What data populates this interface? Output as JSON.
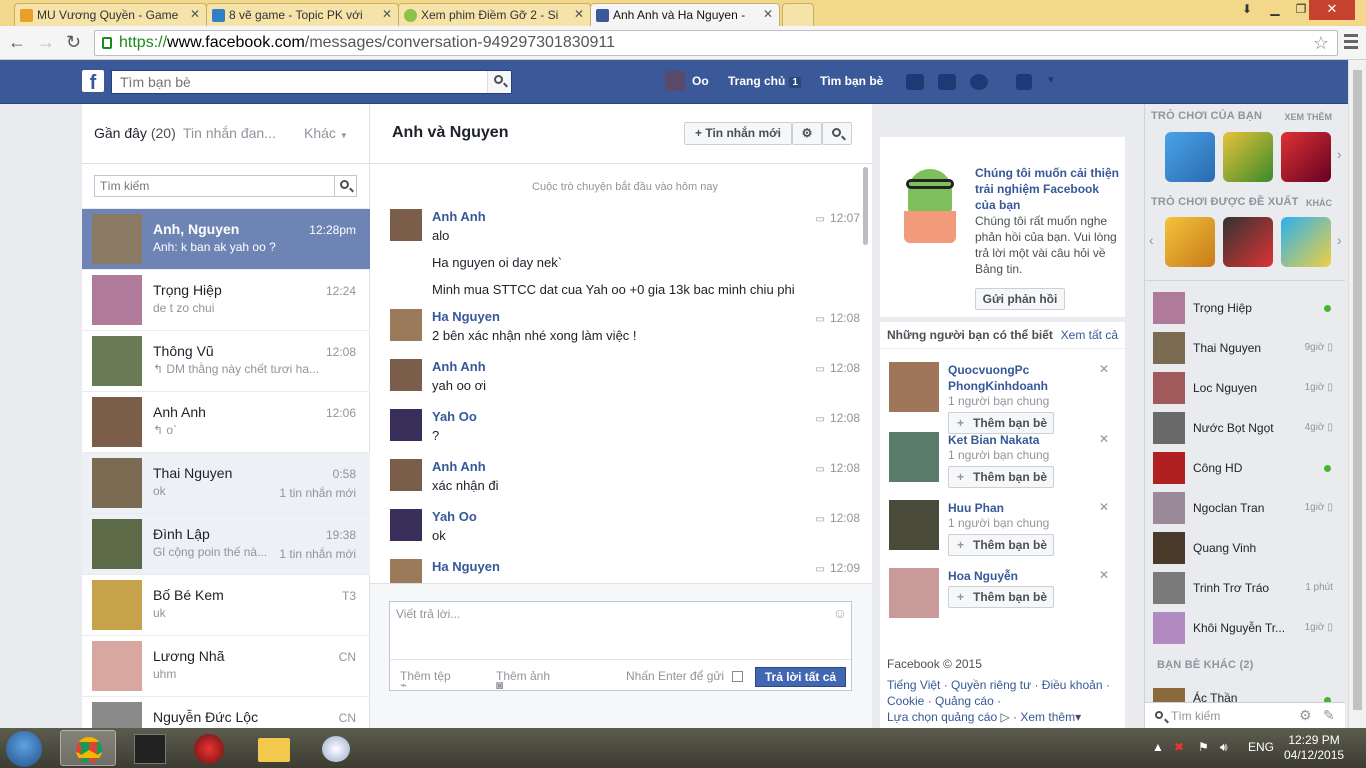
{
  "browser": {
    "tabs": [
      {
        "title": "MU Vương Quyền - Game",
        "color": "#e8a02a"
      },
      {
        "title": "8 vẽ game - Topic PK với",
        "color": "#2f80c9"
      },
      {
        "title": "Xem phim Điềm Gỡ 2 - Si",
        "color": "#8bc34a"
      },
      {
        "title": "Anh Anh và Ha Nguyen -",
        "color": "#3b5998"
      }
    ],
    "url_scheme": "https://",
    "url_host": "www.facebook.com",
    "url_path": "/messages/conversation-949297301830911"
  },
  "fb_header": {
    "logo": "f",
    "search_placeholder": "Tìm bạn bè",
    "profile_name": "Oo",
    "home_label": "Trang chủ",
    "home_badge": "1",
    "find_friends_label": "Tìm bạn bè"
  },
  "left_panel": {
    "recent_label": "Gần đây",
    "recent_count": "(20)",
    "other_tab": "Tin nhắn đan...",
    "more_label": "Khác",
    "search_placeholder": "Tìm kiếm",
    "conversations": [
      {
        "name": "Anh, Nguyen",
        "snippet": "Anh: k ban ak yah oo ?",
        "time": "12:28pm",
        "new": "",
        "state": "sel",
        "color": "#8a7a64"
      },
      {
        "name": "Trọng Hiệp",
        "snippet": "de t zo chui",
        "time": "12:24",
        "new": "",
        "state": "",
        "color": "#b07a9a"
      },
      {
        "name": "Thông Vũ",
        "snippet": "↰ DM thằng này chết tươi ha...",
        "time": "12:08",
        "new": "",
        "state": "",
        "color": "#6a7a55"
      },
      {
        "name": "Anh Anh",
        "snippet": "↰ o`",
        "time": "12:06",
        "new": "",
        "state": "",
        "color": "#7b5e4a"
      },
      {
        "name": "Thai Nguyen",
        "snippet": "ok",
        "time": "0:58",
        "new": "1 tin nhắn mới",
        "state": "unread",
        "color": "#7a6b52"
      },
      {
        "name": "Đình Lập",
        "snippet": "Gl cộng poin thế nà...",
        "time": "19:38",
        "new": "1 tin nhắn mới",
        "state": "unread",
        "color": "#5c6a48"
      },
      {
        "name": "Bố Bé Kem",
        "snippet": "uk",
        "time": "T3",
        "new": "",
        "state": "",
        "color": "#c6a34a"
      },
      {
        "name": "Lương Nhã",
        "snippet": "uhm",
        "time": "CN",
        "new": "",
        "state": "",
        "color": "#d8a8a0"
      },
      {
        "name": "Nguyễn Đức Lộc",
        "snippet": "",
        "time": "CN",
        "new": "",
        "state": "",
        "color": "#8a8a8a"
      }
    ]
  },
  "conversation": {
    "title": "Anh và Nguyen",
    "new_message_button": "+ Tin nhắn mới",
    "start_note": "Cuộc trò chuyện bắt đầu vào hôm nay",
    "messages": [
      {
        "name": "Anh Anh",
        "time": "12:07",
        "lines": [
          "alo",
          "Ha nguyen oi day nek`",
          "Minh mua STTCC dat cua Yah oo +0 gia 13k bac minh chiu phi"
        ],
        "color": "#7b5e4a"
      },
      {
        "name": "Ha Nguyen",
        "time": "12:08",
        "lines": [
          "2 bên xác nhận nhé xong làm việc !"
        ],
        "color": "#9a7a5a"
      },
      {
        "name": "Anh Anh",
        "time": "12:08",
        "lines": [
          "yah oo ơi"
        ],
        "color": "#7b5e4a"
      },
      {
        "name": "Yah Oo",
        "time": "12:08",
        "lines": [
          "?"
        ],
        "color": "#3a2e5a"
      },
      {
        "name": "Anh Anh",
        "time": "12:08",
        "lines": [
          "xác nhận đi"
        ],
        "color": "#7b5e4a"
      },
      {
        "name": "Yah Oo",
        "time": "12:08",
        "lines": [
          "ok"
        ],
        "color": "#3a2e5a"
      },
      {
        "name": "Ha Nguyen",
        "time": "12:09",
        "lines": [],
        "color": "#9a7a5a"
      }
    ],
    "reply_placeholder": "Viết trả lời...",
    "add_file": "Thêm tệp",
    "add_photo": "Thêm ảnh",
    "enter_to_send": "Nhấn Enter để gửi",
    "reply_all_button": "Trả lời tất cả"
  },
  "feedback": {
    "title": "Chúng tôi muốn cải thiện trải nghiệm Facebook của bạn",
    "desc": "Chúng tôi rất muốn nghe phản hồi của bạn. Vui lòng trả lời một vài câu hỏi về Bảng tin.",
    "button": "Gửi phản hồi"
  },
  "pymk": {
    "title": "Những người bạn có thể biết",
    "see_all": "Xem tất cả",
    "add_label": "Thêm bạn bè",
    "people": [
      {
        "name": "QuocvuongPc PhongKinhdoanh",
        "mutual": "1 người bạn chung",
        "color": "#a0765a"
      },
      {
        "name": "Ket Bian Nakata",
        "mutual": "1 người bạn chung",
        "color": "#5a7a6a"
      },
      {
        "name": "Huu Phan",
        "mutual": "1 người bạn chung",
        "color": "#4a4a3a"
      },
      {
        "name": "Hoa Nguyễn",
        "mutual": "",
        "color": "#c89a9a"
      }
    ]
  },
  "footer": {
    "copyright": "Facebook © 2015",
    "links": [
      "Tiếng Việt",
      "Quyền riêng tư",
      "Điều khoản",
      "Cookie",
      "Quảng cáo",
      "Lựa chọn quảng cáo",
      "Xem thêm"
    ]
  },
  "chat_sidebar": {
    "games_title": "TRÒ CHƠI CỦA BẠN",
    "games_more": "XEM THÊM",
    "suggested_title": "TRÒ CHƠI ĐƯỢC ĐỀ XUẤT",
    "suggested_more": "KHÁC",
    "friends": [
      {
        "name": "Trọng Hiệp",
        "status": "",
        "online": true,
        "color": "#b07a9a"
      },
      {
        "name": "Thai Nguyen",
        "status": "9giờ",
        "online": false,
        "color": "#7a6b52"
      },
      {
        "name": "Loc Nguyen",
        "status": "1giờ",
        "online": false,
        "color": "#a05a5a"
      },
      {
        "name": "Nước Bọt Ngọt",
        "status": "4giờ",
        "online": false,
        "color": "#6a6a6a"
      },
      {
        "name": "Công HD",
        "status": "",
        "online": true,
        "color": "#b02020"
      },
      {
        "name": "Ngoclan Tran",
        "status": "1giờ",
        "online": false,
        "color": "#9a8a9a"
      },
      {
        "name": "Quang Vinh",
        "status": "",
        "online": false,
        "color": "#4a3a2a"
      },
      {
        "name": "Trinh Trơ Tráo",
        "status": "1 phút",
        "online": false,
        "color": "#7a7a7a"
      },
      {
        "name": "Khôi Nguyễn Tr...",
        "status": "1giờ",
        "online": false,
        "color": "#b08ac0"
      }
    ],
    "other_friends_title": "BẠN BÈ KHÁC (2)",
    "other_friend": "Ác Thần",
    "search_placeholder": "Tìm kiếm"
  },
  "taskbar": {
    "lang": "ENG",
    "time": "12:29 PM",
    "date": "04/12/2015"
  }
}
